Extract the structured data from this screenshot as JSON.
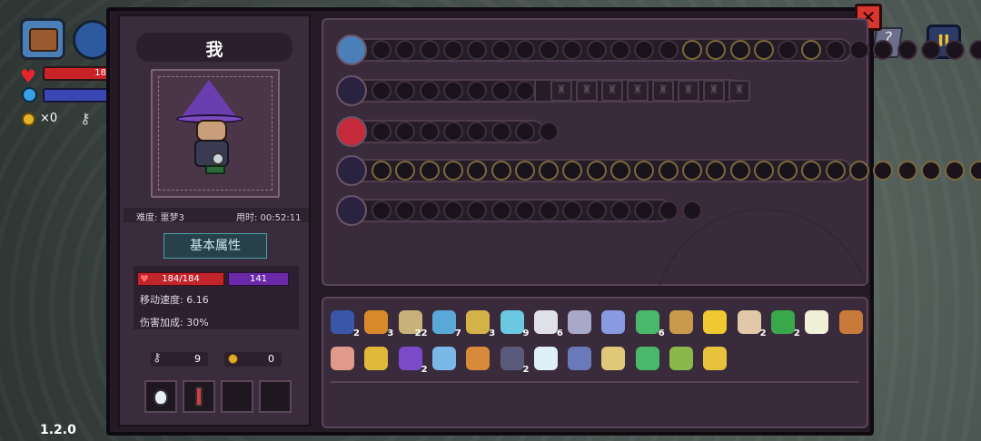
{
  "hud": {
    "hp_value": "18",
    "coin_count": "×0",
    "pause_label": "II",
    "book_label": "?",
    "version": "1.2.0"
  },
  "panel": {
    "close_label": "✕",
    "character_name": "我",
    "difficulty_label": "难度: 噩梦3",
    "time_label": "用时: 00:52:11",
    "section_title": "基本属性",
    "hp": "184/184",
    "mp": "141",
    "move_speed": "移动速度: 6.16",
    "damage_bonus": "伤害加成: 30%",
    "keys": "9",
    "coins": "0",
    "consumable_slots": [
      "white-potion",
      "red-potion",
      "",
      ""
    ]
  },
  "equipment_rows": [
    {
      "name": "chest",
      "total_slots": 27,
      "filled_indices": [
        13,
        14,
        15,
        16,
        18
      ]
    },
    {
      "name": "sword",
      "total_slots": 8,
      "locked_slots": 8
    },
    {
      "name": "gem",
      "total_slots": 8,
      "filled_indices": []
    },
    {
      "name": "staff",
      "total_slots": 27,
      "filled_indices": [
        0,
        1,
        2,
        3,
        4,
        5,
        6,
        7,
        8,
        9,
        10,
        11,
        12,
        13,
        14,
        15,
        16,
        17,
        18,
        19,
        20,
        21,
        22,
        23,
        24,
        25,
        26
      ]
    },
    {
      "name": "wand",
      "total_slots": 14,
      "filled_indices": []
    }
  ],
  "inventory": {
    "row1": [
      {
        "name": "skull-helm",
        "count": "2",
        "color": "#3a56a8"
      },
      {
        "name": "bow-fire",
        "count": "3",
        "color": "#d88a2a"
      },
      {
        "name": "arrows",
        "count": "22",
        "color": "#c8b27a"
      },
      {
        "name": "bow-blue",
        "count": "7",
        "color": "#5aa8d8"
      },
      {
        "name": "crossbow",
        "count": "3",
        "color": "#d4b24a"
      },
      {
        "name": "bow-ice",
        "count": "9",
        "color": "#6ac8e0"
      },
      {
        "name": "bow-light",
        "count": "6",
        "color": "#e0e0e8"
      },
      {
        "name": "feather-quill",
        "count": "",
        "color": "#a8a8c8"
      },
      {
        "name": "water-drop",
        "count": "",
        "color": "#8a9ae0"
      },
      {
        "name": "bow-green",
        "count": "6",
        "color": "#4ab86a"
      },
      {
        "name": "treasure-map",
        "count": "",
        "color": "#c89a4a"
      },
      {
        "name": "potion-cone",
        "count": "",
        "color": "#f0c832"
      },
      {
        "name": "bone-club",
        "count": "2",
        "color": "#e0c8a8"
      },
      {
        "name": "herb",
        "count": "2",
        "color": "#3aa84a"
      },
      {
        "name": "fangs",
        "count": "",
        "color": "#f0f0d8"
      },
      {
        "name": "gauntlet",
        "count": "",
        "color": "#c87a3a"
      }
    ],
    "row2": [
      {
        "name": "ear",
        "count": "",
        "color": "#e09a8a"
      },
      {
        "name": "magnifier",
        "count": "",
        "color": "#e0b83a"
      },
      {
        "name": "wizard-hat",
        "count": "2",
        "color": "#7a4ac8"
      },
      {
        "name": "crystal-orb",
        "count": "",
        "color": "#7ab8e8"
      },
      {
        "name": "slingshot",
        "count": "",
        "color": "#d88a3a"
      },
      {
        "name": "dark-helm",
        "count": "2",
        "color": "#5a5a7a"
      },
      {
        "name": "lotus",
        "count": "",
        "color": "#e0f0f8"
      },
      {
        "name": "scroll-hand",
        "count": "",
        "color": "#6a7ab8"
      },
      {
        "name": "hourglass",
        "count": "",
        "color": "#e0c87a"
      },
      {
        "name": "boot",
        "count": "",
        "color": "#4ab86a"
      },
      {
        "name": "arrow-leaf",
        "count": "",
        "color": "#8ab84a"
      },
      {
        "name": "bell",
        "count": "",
        "color": "#e8c23a"
      }
    ]
  }
}
